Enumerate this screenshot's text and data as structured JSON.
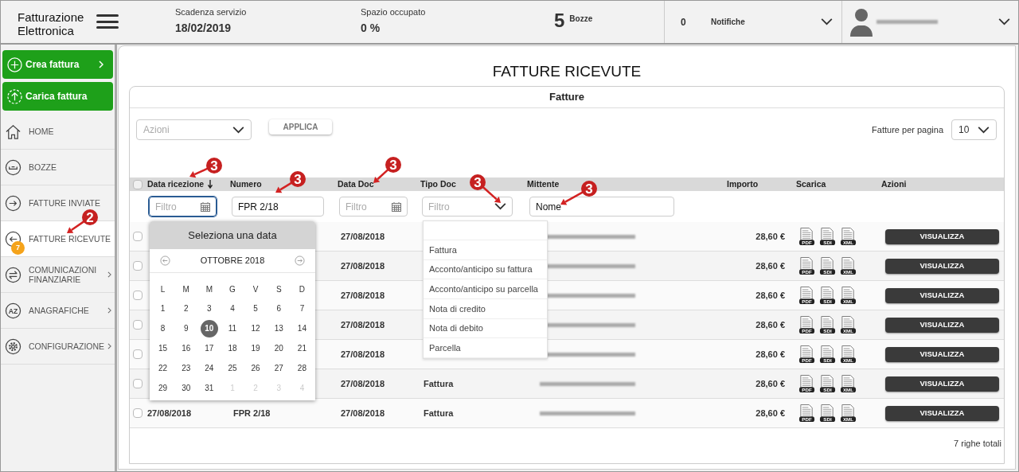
{
  "header": {
    "logo": "Fatturazione Elettronica",
    "stats": [
      {
        "label": "Scadenza servizio",
        "value": "18/02/2019"
      },
      {
        "label": "Spazio occupato",
        "value": "0 %"
      }
    ],
    "drafts": {
      "count": "5",
      "label": "Bozze"
    },
    "notifications": {
      "count": "0",
      "label": "Notifiche"
    }
  },
  "sidebar": {
    "actions": [
      {
        "label": "Crea fattura",
        "arrow": true
      },
      {
        "label": "Carica fattura",
        "arrow": false
      }
    ],
    "items": [
      {
        "label": "HOME",
        "selected": false,
        "arrow": false
      },
      {
        "label": "BOZZE",
        "selected": false,
        "arrow": false
      },
      {
        "label": "FATTURE INVIATE",
        "selected": false,
        "arrow": false
      },
      {
        "label": "FATTURE RICEVUTE",
        "selected": true,
        "arrow": false,
        "badge": "7"
      },
      {
        "label": "COMUNICAZIONI FINANZIARIE",
        "selected": false,
        "arrow": true
      },
      {
        "label": "ANAGRAFICHE",
        "selected": false,
        "arrow": true,
        "icon_text": "AZ"
      },
      {
        "label": "CONFIGURAZIONE",
        "selected": false,
        "arrow": true
      }
    ]
  },
  "page": {
    "title": "FATTURE RICEVUTE",
    "tab": "Fatture",
    "actions_select": {
      "placeholder": "Azioni"
    },
    "apply_button": "APPLICA",
    "per_page": {
      "label": "Fatture per pagina",
      "value": "10"
    }
  },
  "table": {
    "select_all": {
      "checked": false
    },
    "columns": [
      {
        "label": "Data ricezione",
        "sorted": true
      },
      {
        "label": "Numero",
        "sorted": false
      },
      {
        "label": "Data Doc",
        "sorted": false
      },
      {
        "label": "Tipo Doc",
        "sorted": false
      },
      {
        "label": "Mittente",
        "sorted": false
      },
      {
        "label": "Importo",
        "sorted": false
      },
      {
        "label": "Scarica",
        "sorted": false
      },
      {
        "label": "Azioni",
        "sorted": false
      }
    ],
    "filters": [
      {
        "kind": "date",
        "placeholder": "Filtro",
        "focused": true
      },
      {
        "kind": "text",
        "value": "FPR 2/18",
        "focused": false
      },
      {
        "kind": "date",
        "placeholder": "Filtro",
        "focused": false
      },
      {
        "kind": "select",
        "placeholder": "Filtro",
        "focused": false
      },
      {
        "kind": "text",
        "value": "Nome",
        "focused": false
      }
    ],
    "rows": [
      {
        "checked": false,
        "data_doc": "27/08/2018",
        "importo": "28,60 €",
        "downloads": [
          "PDF",
          "SDI",
          "XML"
        ],
        "action": "VISUALIZZA"
      },
      {
        "checked": false,
        "data_doc": "27/08/2018",
        "importo": "28,60 €",
        "downloads": [
          "PDF",
          "SDI",
          "XML"
        ],
        "action": "VISUALIZZA"
      },
      {
        "checked": false,
        "data_doc": "27/08/2018",
        "importo": "28,60 €",
        "downloads": [
          "PDF",
          "SDI",
          "XML"
        ],
        "action": "VISUALIZZA"
      },
      {
        "checked": false,
        "data_doc": "27/08/2018",
        "importo": "28,60 €",
        "downloads": [
          "PDF",
          "SDI",
          "XML"
        ],
        "action": "VISUALIZZA"
      },
      {
        "checked": false,
        "data_doc": "27/08/2018",
        "importo": "28,60 €",
        "downloads": [
          "PDF",
          "SDI",
          "XML"
        ],
        "action": "VISUALIZZA"
      },
      {
        "checked": false,
        "data_doc": "27/08/2018",
        "tipo_doc": "Fattura",
        "importo": "28,60 €",
        "downloads": [
          "PDF",
          "SDI",
          "XML"
        ],
        "action": "VISUALIZZA"
      },
      {
        "checked": false,
        "data_ricezione": "27/08/2018",
        "numero": "FPR 2/18",
        "data_doc": "27/08/2018",
        "tipo_doc": "Fattura",
        "importo": "28,60 €",
        "downloads": [
          "PDF",
          "SDI",
          "XML"
        ],
        "action": "VISUALIZZA"
      }
    ],
    "total": "7 righe totali"
  },
  "date_picker": {
    "title": "Seleziona una data",
    "month": "OTTOBRE 2018",
    "weekdays": [
      "L",
      "M",
      "M",
      "G",
      "V",
      "S",
      "D"
    ],
    "days": [
      {
        "label": "1",
        "selected": false,
        "outside": false
      },
      {
        "label": "2",
        "selected": false,
        "outside": false
      },
      {
        "label": "3",
        "selected": false,
        "outside": false
      },
      {
        "label": "4",
        "selected": false,
        "outside": false
      },
      {
        "label": "5",
        "selected": false,
        "outside": false
      },
      {
        "label": "6",
        "selected": false,
        "outside": false
      },
      {
        "label": "7",
        "selected": false,
        "outside": false
      },
      {
        "label": "8",
        "selected": false,
        "outside": false
      },
      {
        "label": "9",
        "selected": false,
        "outside": false
      },
      {
        "label": "10",
        "selected": true,
        "outside": false
      },
      {
        "label": "11",
        "selected": false,
        "outside": false
      },
      {
        "label": "12",
        "selected": false,
        "outside": false
      },
      {
        "label": "13",
        "selected": false,
        "outside": false
      },
      {
        "label": "14",
        "selected": false,
        "outside": false
      },
      {
        "label": "15",
        "selected": false,
        "outside": false
      },
      {
        "label": "16",
        "selected": false,
        "outside": false
      },
      {
        "label": "17",
        "selected": false,
        "outside": false
      },
      {
        "label": "18",
        "selected": false,
        "outside": false
      },
      {
        "label": "19",
        "selected": false,
        "outside": false
      },
      {
        "label": "20",
        "selected": false,
        "outside": false
      },
      {
        "label": "21",
        "selected": false,
        "outside": false
      },
      {
        "label": "22",
        "selected": false,
        "outside": false
      },
      {
        "label": "23",
        "selected": false,
        "outside": false
      },
      {
        "label": "24",
        "selected": false,
        "outside": false
      },
      {
        "label": "25",
        "selected": false,
        "outside": false
      },
      {
        "label": "26",
        "selected": false,
        "outside": false
      },
      {
        "label": "27",
        "selected": false,
        "outside": false
      },
      {
        "label": "28",
        "selected": false,
        "outside": false
      },
      {
        "label": "29",
        "selected": false,
        "outside": false
      },
      {
        "label": "30",
        "selected": false,
        "outside": false
      },
      {
        "label": "31",
        "selected": false,
        "outside": false
      },
      {
        "label": "1",
        "selected": false,
        "outside": true
      },
      {
        "label": "2",
        "selected": false,
        "outside": true
      },
      {
        "label": "3",
        "selected": false,
        "outside": true
      },
      {
        "label": "4",
        "selected": false,
        "outside": true
      }
    ]
  },
  "type_dropdown": {
    "options": [
      "Fattura",
      "Acconto/anticipo su fattura",
      "Acconto/anticipo su parcella",
      "Nota di credito",
      "Nota di debito",
      "Parcella"
    ]
  },
  "annotations": [
    {
      "label": "2"
    },
    {
      "label": "3"
    },
    {
      "label": "3"
    },
    {
      "label": "3"
    },
    {
      "label": "3"
    },
    {
      "label": "3"
    }
  ]
}
